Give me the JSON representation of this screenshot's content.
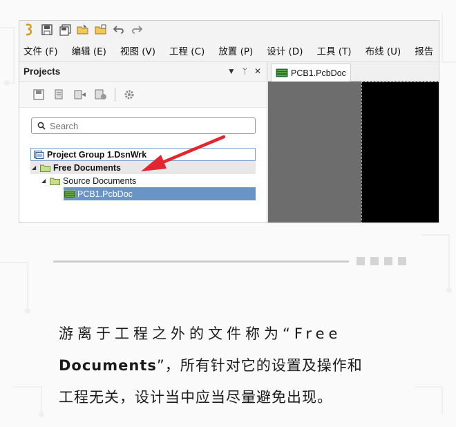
{
  "menu": [
    "文件 (F)",
    "编辑 (E)",
    "视图 (V)",
    "工程 (C)",
    "放置 (P)",
    "设计 (D)",
    "工具 (T)",
    "布线 (U)",
    "报告"
  ],
  "projects_panel": {
    "title": "Projects",
    "controls": [
      "▼",
      "ᛘ",
      "✕"
    ],
    "search_placeholder": "Search",
    "tree": {
      "group": "Project Group 1.DsnWrk",
      "free_documents": "Free Documents",
      "source_documents": "Source Documents",
      "pcb_file": "PCB1.PcbDoc"
    }
  },
  "document_tab": "PCB1.PcbDoc",
  "caption": {
    "line1": "游离于工程之外的文件称为“Free",
    "line2_bold": "Documents",
    "line2_rest": "”，所有针对它的设置及操作和",
    "line3": "工程无关，设计当中应当尽量避免出现。"
  },
  "colors": {
    "selection": "#6a94c6",
    "arrow": "#e3262d",
    "canvas_gray": "#6d6d6d",
    "canvas_black": "#000000"
  }
}
